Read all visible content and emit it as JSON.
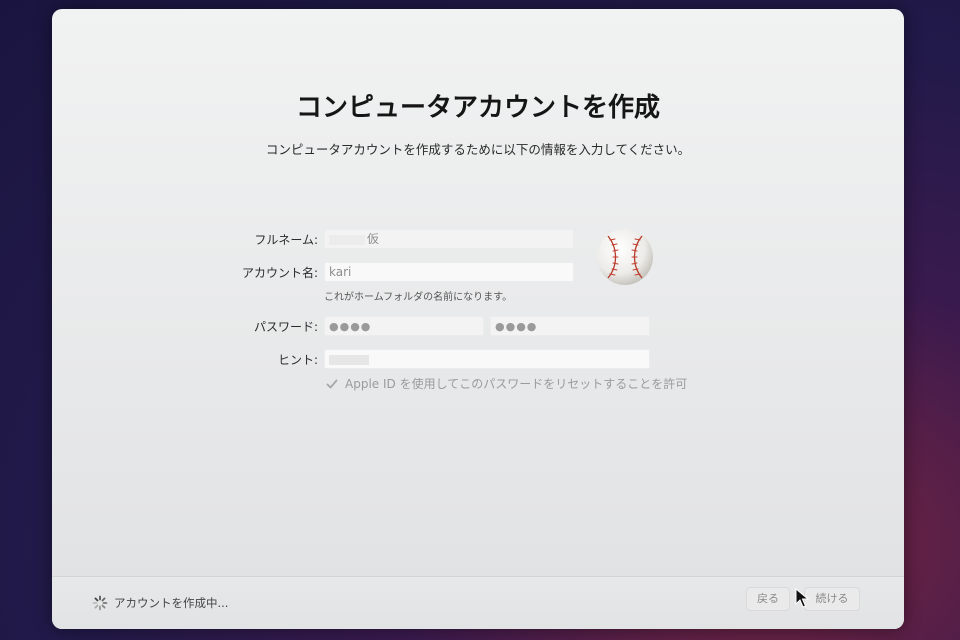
{
  "dialog": {
    "title": "コンピュータアカウントを作成",
    "subtitle": "コンピュータアカウントを作成するために以下の情報を入力してください。"
  },
  "form": {
    "full_name": {
      "label": "フルネーム:",
      "value": "仮"
    },
    "account_name": {
      "label": "アカウント名:",
      "value": "kari",
      "note": "これがホームフォルダの名前になります。"
    },
    "password": {
      "label": "パスワード:",
      "value": "●●●●",
      "verify_value": "●●●●"
    },
    "hint": {
      "label": "ヒント:",
      "value": ""
    },
    "apple_id_reset": {
      "label": "Apple ID を使用してこのパスワードをリセットすることを許可",
      "checked": true
    }
  },
  "avatar": {
    "icon": "baseball-icon"
  },
  "footer": {
    "status": "アカウントを作成中...",
    "back_label": "戻る",
    "continue_label": "続ける"
  }
}
